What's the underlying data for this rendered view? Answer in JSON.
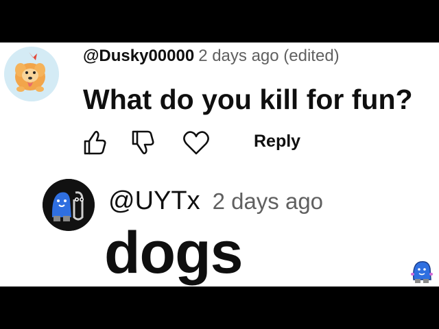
{
  "comment": {
    "username": "@Dusky00000",
    "meta": "2 days ago (edited)",
    "text": "What do you kill for fun?",
    "actions": {
      "like_icon": "thumbs-up-icon",
      "dislike_icon": "thumbs-down-icon",
      "heart_icon": "heart-icon",
      "reply_label": "Reply"
    }
  },
  "reply": {
    "username": "@UYTx",
    "meta": "2 days ago",
    "text": "dogs"
  },
  "colors": {
    "text_primary": "#0f0f0f",
    "text_secondary": "#606060",
    "letterbox": "#000000",
    "mascot_blue": "#2f6fe0"
  }
}
